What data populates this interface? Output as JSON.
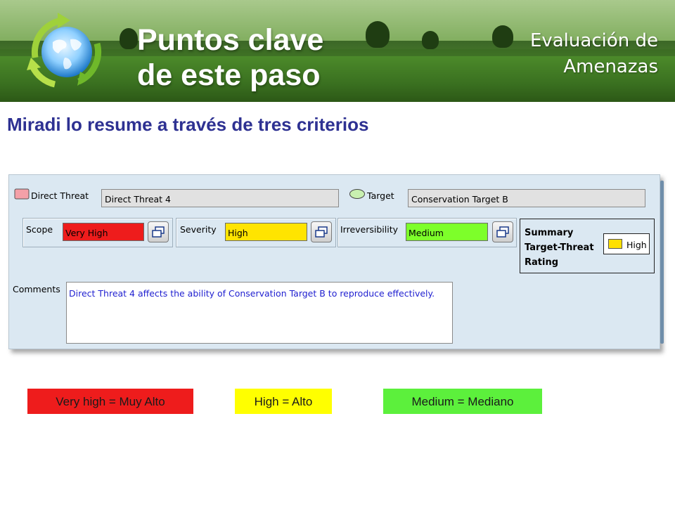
{
  "header": {
    "title": "Puntos clave\nde este paso",
    "section": "Evaluación de\nAmenazas"
  },
  "subtitle": "Miradi lo resume a través de tres criterios",
  "form": {
    "direct_threat_label": "Direct Threat",
    "direct_threat_value": "Direct Threat 4",
    "target_label": "Target",
    "target_value": "Conservation Target B",
    "scope": {
      "label": "Scope",
      "value": "Very High",
      "color": "#ee1c1c"
    },
    "severity": {
      "label": "Severity",
      "value": "High",
      "color": "#ffe400"
    },
    "irreversibility": {
      "label": "Irreversibility",
      "value": "Medium",
      "color": "#7dff2a"
    },
    "summary": {
      "label": "Summary\nTarget-Threat\nRating",
      "value": "High",
      "color": "#ffe000"
    },
    "comments_label": "Comments",
    "comments_value": "Direct Threat 4 affects the ability of Conservation Target B to reproduce effectively."
  },
  "legend": [
    {
      "text": "Very high = Muy Alto",
      "color": "#ee1c1c"
    },
    {
      "text": "High = Alto",
      "color": "#ffff00"
    },
    {
      "text": "Medium = Mediano",
      "color": "#5cf03c"
    }
  ]
}
